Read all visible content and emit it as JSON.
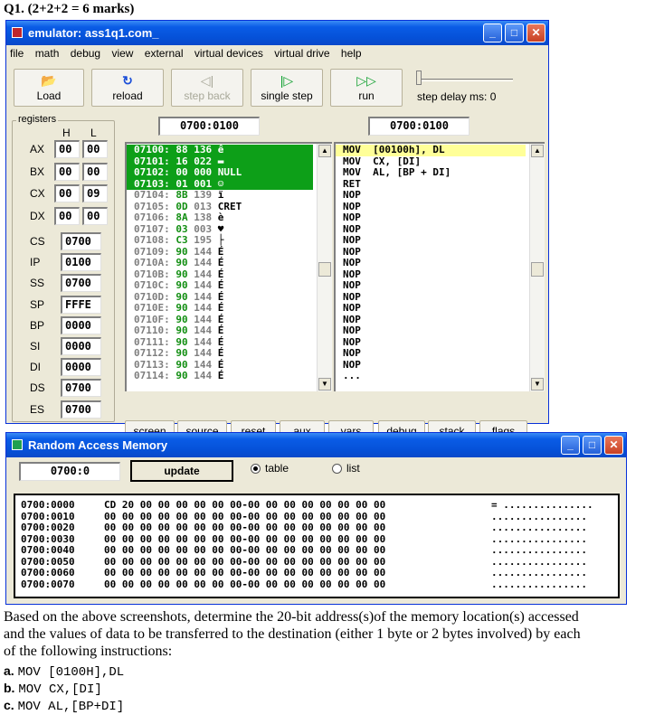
{
  "heading": "Q1. (2+2+2 = 6 marks)",
  "emulator": {
    "title": "emulator: ass1q1.com_",
    "menu": [
      "file",
      "math",
      "debug",
      "view",
      "external",
      "virtual devices",
      "virtual drive",
      "help"
    ],
    "toolbar": {
      "load": "Load",
      "reload": "reload",
      "step_back": "step back",
      "single_step": "single step",
      "run": "run",
      "step_delay": "step delay ms: 0"
    },
    "registers_label": "registers",
    "h_label": "H",
    "l_label": "L",
    "regs_hl": [
      {
        "name": "AX",
        "h": "00",
        "l": "00"
      },
      {
        "name": "BX",
        "h": "00",
        "l": "00"
      },
      {
        "name": "CX",
        "h": "00",
        "l": "09"
      },
      {
        "name": "DX",
        "h": "00",
        "l": "00"
      }
    ],
    "regs_16": [
      {
        "name": "CS",
        "value": "0700"
      },
      {
        "name": "IP",
        "value": "0100"
      },
      {
        "name": "SS",
        "value": "0700"
      },
      {
        "name": "SP",
        "value": "FFFE"
      },
      {
        "name": "BP",
        "value": "0000"
      },
      {
        "name": "SI",
        "value": "0000"
      },
      {
        "name": "DI",
        "value": "0000"
      },
      {
        "name": "DS",
        "value": "0700"
      },
      {
        "name": "ES",
        "value": "0700"
      }
    ],
    "mem_address": "0700:0100",
    "disasm_address": "0700:0100",
    "memory": [
      {
        "addr": "07100:",
        "hex": "88",
        "dec": "136",
        "ch": "ê",
        "selected": true
      },
      {
        "addr": "07101:",
        "hex": "16",
        "dec": "022",
        "ch": "▬",
        "selected": true
      },
      {
        "addr": "07102:",
        "hex": "00",
        "dec": "000",
        "ch": "NULL",
        "selected": true
      },
      {
        "addr": "07103:",
        "hex": "01",
        "dec": "001",
        "ch": "☺",
        "selected": true
      },
      {
        "addr": "07104:",
        "hex": "8B",
        "dec": "139",
        "ch": "ï",
        "selected": false
      },
      {
        "addr": "07105:",
        "hex": "0D",
        "dec": "013",
        "ch": "CRET",
        "selected": false
      },
      {
        "addr": "07106:",
        "hex": "8A",
        "dec": "138",
        "ch": "è",
        "selected": false
      },
      {
        "addr": "07107:",
        "hex": "03",
        "dec": "003",
        "ch": "♥",
        "selected": false
      },
      {
        "addr": "07108:",
        "hex": "C3",
        "dec": "195",
        "ch": "├",
        "selected": false
      },
      {
        "addr": "07109:",
        "hex": "90",
        "dec": "144",
        "ch": "É",
        "selected": false
      },
      {
        "addr": "0710A:",
        "hex": "90",
        "dec": "144",
        "ch": "É",
        "selected": false
      },
      {
        "addr": "0710B:",
        "hex": "90",
        "dec": "144",
        "ch": "É",
        "selected": false
      },
      {
        "addr": "0710C:",
        "hex": "90",
        "dec": "144",
        "ch": "É",
        "selected": false
      },
      {
        "addr": "0710D:",
        "hex": "90",
        "dec": "144",
        "ch": "É",
        "selected": false
      },
      {
        "addr": "0710E:",
        "hex": "90",
        "dec": "144",
        "ch": "É",
        "selected": false
      },
      {
        "addr": "0710F:",
        "hex": "90",
        "dec": "144",
        "ch": "É",
        "selected": false
      },
      {
        "addr": "07110:",
        "hex": "90",
        "dec": "144",
        "ch": "É",
        "selected": false
      },
      {
        "addr": "07111:",
        "hex": "90",
        "dec": "144",
        "ch": "É",
        "selected": false
      },
      {
        "addr": "07112:",
        "hex": "90",
        "dec": "144",
        "ch": "É",
        "selected": false
      },
      {
        "addr": "07113:",
        "hex": "90",
        "dec": "144",
        "ch": "É",
        "selected": false
      },
      {
        "addr": "07114:",
        "hex": "90",
        "dec": "144",
        "ch": "É",
        "selected": false
      }
    ],
    "disasm": [
      {
        "text": "MOV  [00100h], DL",
        "selected": true
      },
      {
        "text": "MOV  CX, [DI]",
        "selected": false
      },
      {
        "text": "MOV  AL, [BP + DI]",
        "selected": false
      },
      {
        "text": "RET",
        "selected": false
      },
      {
        "text": "NOP",
        "selected": false
      },
      {
        "text": "NOP",
        "selected": false
      },
      {
        "text": "NOP",
        "selected": false
      },
      {
        "text": "NOP",
        "selected": false
      },
      {
        "text": "NOP",
        "selected": false
      },
      {
        "text": "NOP",
        "selected": false
      },
      {
        "text": "NOP",
        "selected": false
      },
      {
        "text": "NOP",
        "selected": false
      },
      {
        "text": "NOP",
        "selected": false
      },
      {
        "text": "NOP",
        "selected": false
      },
      {
        "text": "NOP",
        "selected": false
      },
      {
        "text": "NOP",
        "selected": false
      },
      {
        "text": "NOP",
        "selected": false
      },
      {
        "text": "NOP",
        "selected": false
      },
      {
        "text": "NOP",
        "selected": false
      },
      {
        "text": "NOP",
        "selected": false
      },
      {
        "text": "...",
        "selected": false
      }
    ],
    "bottom_buttons": [
      "screen",
      "source",
      "reset",
      "aux",
      "vars",
      "debug",
      "stack",
      "flags"
    ]
  },
  "ram": {
    "title": "Random Access Memory",
    "address": "0700:0",
    "update": "update",
    "opt_table": "table",
    "opt_list": "list",
    "rows": [
      {
        "addr": "0700:0000",
        "bytes": "CD 20 00 00 00 00 00 00-00 00 00 00 00 00 00 00",
        "ascii": "= ..............."
      },
      {
        "addr": "0700:0010",
        "bytes": "00 00 00 00 00 00 00 00-00 00 00 00 00 00 00 00",
        "ascii": "................"
      },
      {
        "addr": "0700:0020",
        "bytes": "00 00 00 00 00 00 00 00-00 00 00 00 00 00 00 00",
        "ascii": "................"
      },
      {
        "addr": "0700:0030",
        "bytes": "00 00 00 00 00 00 00 00-00 00 00 00 00 00 00 00",
        "ascii": "................"
      },
      {
        "addr": "0700:0040",
        "bytes": "00 00 00 00 00 00 00 00-00 00 00 00 00 00 00 00",
        "ascii": "................"
      },
      {
        "addr": "0700:0050",
        "bytes": "00 00 00 00 00 00 00 00-00 00 00 00 00 00 00 00",
        "ascii": "................"
      },
      {
        "addr": "0700:0060",
        "bytes": "00 00 00 00 00 00 00 00-00 00 00 00 00 00 00 00",
        "ascii": "................"
      },
      {
        "addr": "0700:0070",
        "bytes": "00 00 00 00 00 00 00 00-00 00 00 00 00 00 00 00",
        "ascii": "................"
      }
    ]
  },
  "question": {
    "text": "Based on the above screenshots, determine the 20-bit address(s)of the memory location(s) accessed and the values of data to be transferred to the destination (either 1 byte or 2 bytes involved) by each of the following instructions:",
    "items": [
      {
        "letter": "a.",
        "code": "MOV [0100H],DL"
      },
      {
        "letter": "b.",
        "code": "MOV CX,[DI]"
      },
      {
        "letter": "c.",
        "code": "MOV AL,[BP+DI]"
      }
    ]
  }
}
